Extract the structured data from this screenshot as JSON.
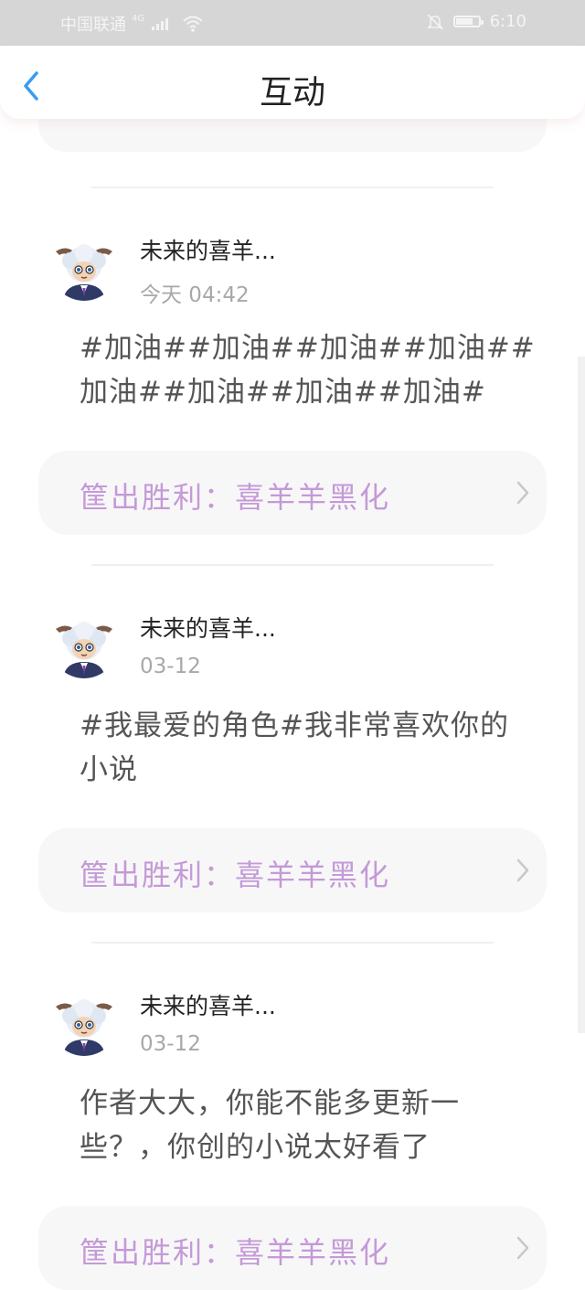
{
  "status_bar": {
    "carrier": "中国联通",
    "network": "4G",
    "time": "6:10",
    "icons": [
      "signal-icon",
      "wifi-icon",
      "mute-icon",
      "battery-icon"
    ]
  },
  "nav": {
    "title": "互动",
    "back_icon": "chevron-left-icon"
  },
  "colors": {
    "accent_blue": "#3a9cf0",
    "book_link_text": "#c49ad7",
    "link_background": "#f8f7f8"
  },
  "posts": [
    {
      "username": "未来的喜羊...",
      "time": "今天 04:42",
      "content": "#加油##加油##加油##加油##加油##加油##加油##加油#",
      "book_link": "筐出胜利：喜羊羊黑化"
    },
    {
      "username": "未来的喜羊...",
      "time": "03-12",
      "content": "#我最爱的角色#我非常喜欢你的小说",
      "book_link": "筐出胜利：喜羊羊黑化"
    },
    {
      "username": "未来的喜羊...",
      "time": "03-12",
      "content": "作者大大，你能不能多更新一些？，你创的小说太好看了",
      "book_link": "筐出胜利：喜羊羊黑化"
    }
  ]
}
